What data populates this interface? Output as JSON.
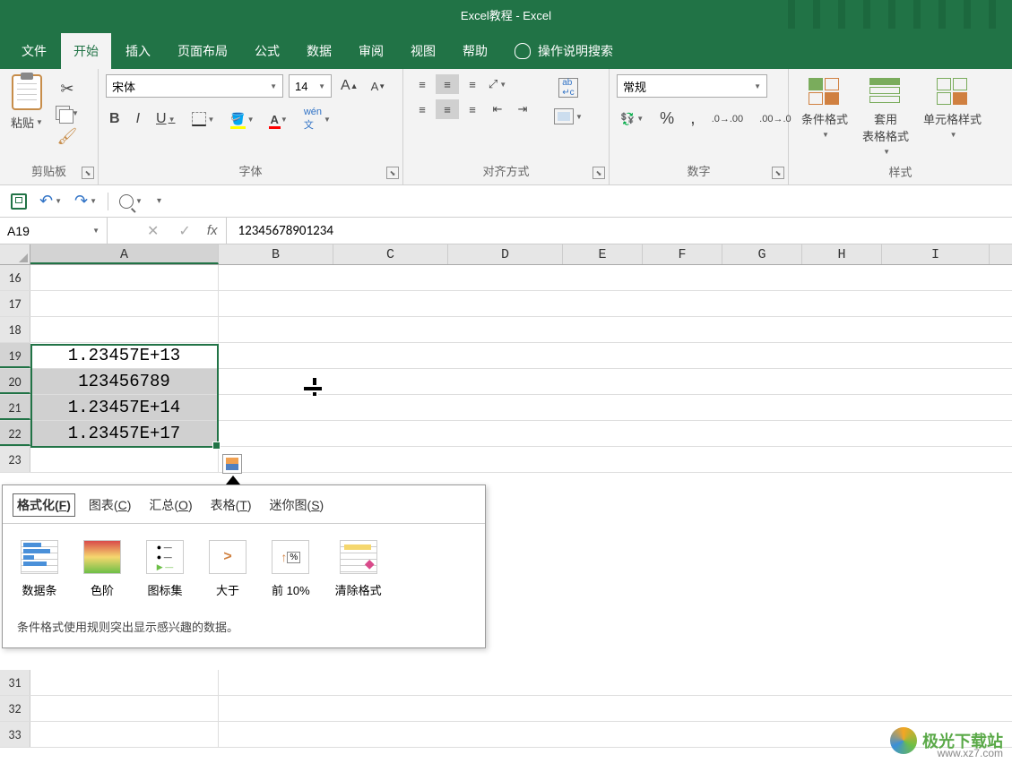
{
  "title": "Excel教程 - Excel",
  "menu": {
    "file": "文件",
    "home": "开始",
    "insert": "插入",
    "layout": "页面布局",
    "formulas": "公式",
    "data": "数据",
    "review": "审阅",
    "view": "视图",
    "help": "帮助",
    "search": "操作说明搜索"
  },
  "ribbon": {
    "clipboard": {
      "paste": "粘贴",
      "label": "剪贴板"
    },
    "font": {
      "name": "宋体",
      "size": "14",
      "bold": "B",
      "italic": "I",
      "underline": "U",
      "label": "字体"
    },
    "alignment": {
      "label": "对齐方式"
    },
    "number": {
      "format": "常规",
      "label": "数字"
    },
    "styles": {
      "cond": "条件格式",
      "table": "套用\n表格格式",
      "cell": "单元格样式",
      "label": "样式"
    }
  },
  "namebox": "A19",
  "formula": "12345678901234",
  "columns": [
    "A",
    "B",
    "C",
    "D",
    "E",
    "F",
    "G",
    "H",
    "I"
  ],
  "rows": {
    "16": {},
    "17": {},
    "18": {},
    "19": {
      "A": "1.23457E+13"
    },
    "20": {
      "A": "123456789"
    },
    "21": {
      "A": "1.23457E+14"
    },
    "22": {
      "A": "1.23457E+17"
    },
    "23": {},
    "31": {},
    "32": {},
    "33": {}
  },
  "quick_analysis": {
    "tabs": {
      "format": "格式化(F)",
      "charts": "图表(C)",
      "totals": "汇总(O)",
      "tables": "表格(T)",
      "sparklines": "迷你图(S)"
    },
    "options": {
      "databars": "数据条",
      "colorscale": "色阶",
      "iconset": "图标集",
      "greater": "大于",
      "top10": "前 10%",
      "clear": "清除格式"
    },
    "desc": "条件格式使用规则突出显示感兴趣的数据。"
  },
  "watermark": {
    "text": "极光下载站",
    "url": "www.xz7.com"
  }
}
